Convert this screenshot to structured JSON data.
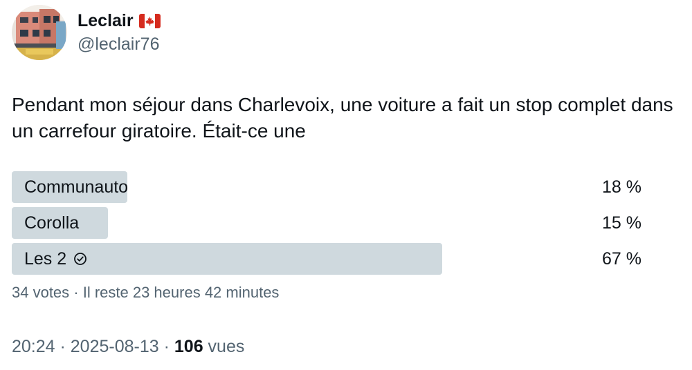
{
  "author": {
    "display_name": "Leclair",
    "flag_icon": "canada-flag-icon",
    "handle": "@leclair76"
  },
  "tweet": {
    "text": "Pendant mon séjour dans Charlevoix, une voiture a fait un stop complet dans un carrefour giratoire. Était-ce une"
  },
  "poll": {
    "options": [
      {
        "label": "Communauto",
        "percent_label": "18 %",
        "percent": 18,
        "selected": false
      },
      {
        "label": "Corolla",
        "percent_label": "15 %",
        "percent": 15,
        "selected": false
      },
      {
        "label": "Les 2",
        "percent_label": "67 %",
        "percent": 67,
        "selected": true,
        "icon": "check-circle-icon"
      }
    ],
    "meta": "34 votes · Il reste 23 heures 42 minutes",
    "bar_color": "#cfd9de"
  },
  "footer": {
    "time": "20:24",
    "separator1": " · ",
    "date": "2025-08-13",
    "separator2": " · ",
    "views_count": "106",
    "views_label": " vues"
  }
}
